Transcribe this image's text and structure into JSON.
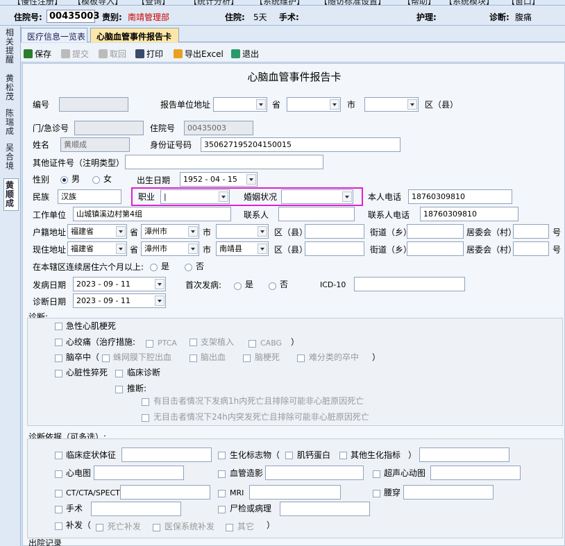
{
  "top_menu": [
    "【慢性注册】",
    "【模板导入】",
    "【查询】",
    "【统计分析】",
    "【系统维护】",
    "【随访标准设置】",
    "【帮助】",
    "【系统模块】",
    "【窗口】"
  ],
  "infobar": {
    "zyh_label": "住院号:",
    "zyh_value": "00435003",
    "ward_label": "责别:",
    "ward_value": "南靖管理部",
    "stay_label": "住院:",
    "stay_value": "5天",
    "op_label": "手术:",
    "op_value": "",
    "nurse_label": "护理:",
    "nurse_value": "",
    "diag_label": "诊断:",
    "diag_value": "腹痛"
  },
  "side_tabs": [
    "相关提醒",
    "黄松茂",
    "陈瑞成",
    "吴合境",
    "黄顺成"
  ],
  "tabs": [
    "医疗信息一览表",
    "心脑血管事件报告卡"
  ],
  "toolbar": {
    "save": "保存",
    "submit": "提交",
    "cancel": "取回",
    "print": "打印",
    "export": "导出Excel",
    "exit": "退出"
  },
  "form": {
    "title": "心脑血管事件报告卡",
    "bianhao": "编号",
    "bgdw": "报告单位地址",
    "sheng": "省",
    "shi": "市",
    "qu": "区（县）",
    "mzh": "门/急诊号",
    "zyh": "住院号",
    "zyh_val": "00435003",
    "xm": "姓名",
    "xm_val": "黄顺成",
    "sfz": "身份证号码",
    "sfz_val": "350627195204150015",
    "qtzj": "其他证件号（注明类型）",
    "xb": "性别",
    "nan": "男",
    "nv": "女",
    "csrq": "出生日期",
    "csrq_val": "1952 - 04 - 15",
    "mz": "民族",
    "mz_val": "汉族",
    "zy": "职业",
    "zy_val": "|",
    "hy": "婚姻状况",
    "brdh": "本人电话",
    "brdh_val": "18760309810",
    "gzdw": "工作单位",
    "gzdw_val": "山城镇溪边村第4组",
    "lxr": "联系人",
    "lxrdh": "联系人电话",
    "lxrdh_val": "18760309810",
    "hjdz": "户籍地址",
    "hj_sheng": "福建省",
    "hj_shi": "漳州市",
    "hj_qu": "",
    "xzdz": "现住地址",
    "xz_sheng": "福建省",
    "xz_shi": "漳州市",
    "xz_qu": "南靖县",
    "jd": "街道（乡）",
    "jwh": "居委会（村）",
    "hao": "号",
    "lxjz": "在本辖区连续居住六个月以上:",
    "shi2": "是",
    "fou": "否",
    "fbrq": "发病日期",
    "fbrq_val": "2023 - 09 - 11",
    "scfb": "首次发病:",
    "icd": "ICD-10",
    "zdrq": "诊断日期",
    "zdrq_val": "2023 - 09 - 11",
    "zd": "诊断:",
    "jxxg": "急性心肌梗死",
    "xjt": "心绞痛（治疗措施:",
    "ptca": "PTCA",
    "zjzr": "支架植入",
    "cabg": "CABG",
    "rp": "）",
    "ncz": "脑卒中（",
    "zwmx": "蛛网膜下腔出血",
    "ncx": "脑出血",
    "ngs": "脑梗死",
    "nfl": "难分类的卒中",
    "rp2": "）",
    "xzxcs": "心脏性猝死",
    "lczd": "临床诊断",
    "tuiduan": "推断:",
    "td1": "有目击者情况下发病1h内死亡且排除可能非心脏原因死亡",
    "td2": "无目击者情况下24h内突发死亡且排除可能非心脏原因死亡",
    "zdyj": "诊断依据（可多选）:",
    "lczz": "临床症状体征",
    "shbz": "生化标志物（",
    "jgdb": "肌钙蛋白",
    "qtsh": "其他生化指标",
    "rp3": "）",
    "xdt": "心电图",
    "xgzy": "血管造影",
    "cxd": "超声心动图",
    "ct": "CT/CTA/SPECT",
    "mri": "MRI",
    "yc": "腰穿",
    "ss": "手术",
    "sjbl": "尸检或病理",
    "bf": "补发（",
    "swbf": "死亡补发",
    "ybbf": "医保系统补发",
    "qt": "其它",
    "rp4": "）",
    "cyjl": "出院记录"
  }
}
